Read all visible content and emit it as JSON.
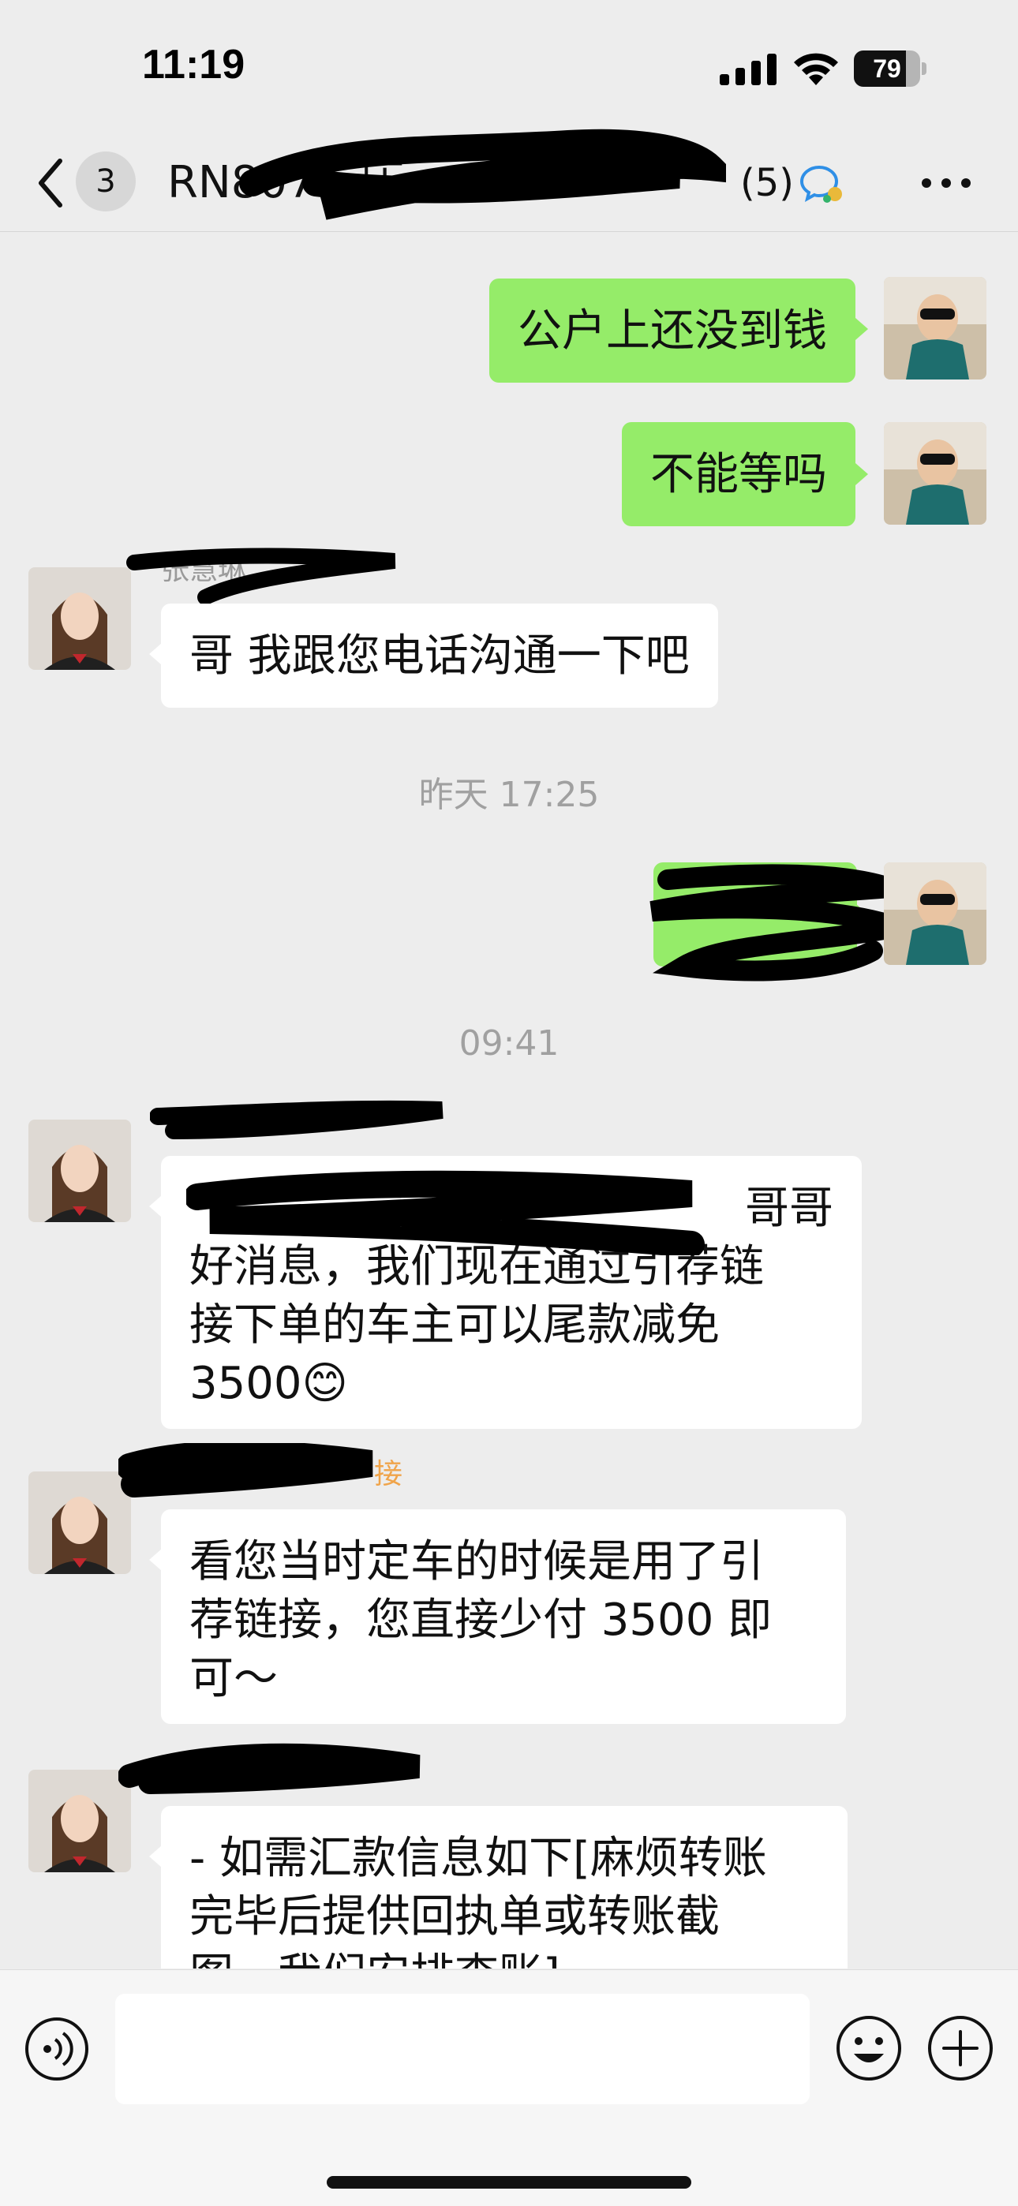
{
  "status_bar": {
    "time": "11:19",
    "battery_percent": 79,
    "battery_label": "79"
  },
  "nav": {
    "unread_count": "3",
    "title": "RN807…压…",
    "member_count": "(5)"
  },
  "messages": [
    {
      "direction": "out",
      "text": "公户上还没到钱"
    },
    {
      "direction": "out",
      "text": "不能等吗"
    },
    {
      "direction": "in",
      "sender": "张慧琳",
      "text": "哥 我跟您电话沟通一下吧"
    },
    {
      "type": "timestamp",
      "text": "昨天 17:25"
    },
    {
      "direction": "out",
      "text": "[redacted]"
    },
    {
      "type": "timestamp",
      "text": "09:41"
    },
    {
      "direction": "in",
      "sender": "[redacted]",
      "lines": [
        "哥哥",
        "好消息，我们现在通过引荐链",
        "接下单的车主可以尾款减免",
        "3500😊"
      ]
    },
    {
      "direction": "in",
      "sender": "接",
      "lines": [
        "看您当时定车的时候是用了引",
        "荐链接，您直接少付 3500 即",
        "可～"
      ]
    },
    {
      "direction": "in",
      "sender": "[redacted]",
      "lines": [
        "- 如需汇款信息如下[麻烦转账",
        "完毕后提供回执单或转账截",
        "图，我们安排查账]"
      ]
    }
  ],
  "input": {
    "placeholder": ""
  },
  "colors": {
    "background": "#ededed",
    "bubble_out": "#95ec69",
    "bubble_in": "#ffffff",
    "timestamp": "#a0a0a0"
  },
  "icons": [
    "signal-icon",
    "wifi-icon",
    "battery-icon",
    "back-chevron-icon",
    "group-chat-icon",
    "more-icon",
    "voice-icon",
    "emoji-icon",
    "plus-icon"
  ]
}
